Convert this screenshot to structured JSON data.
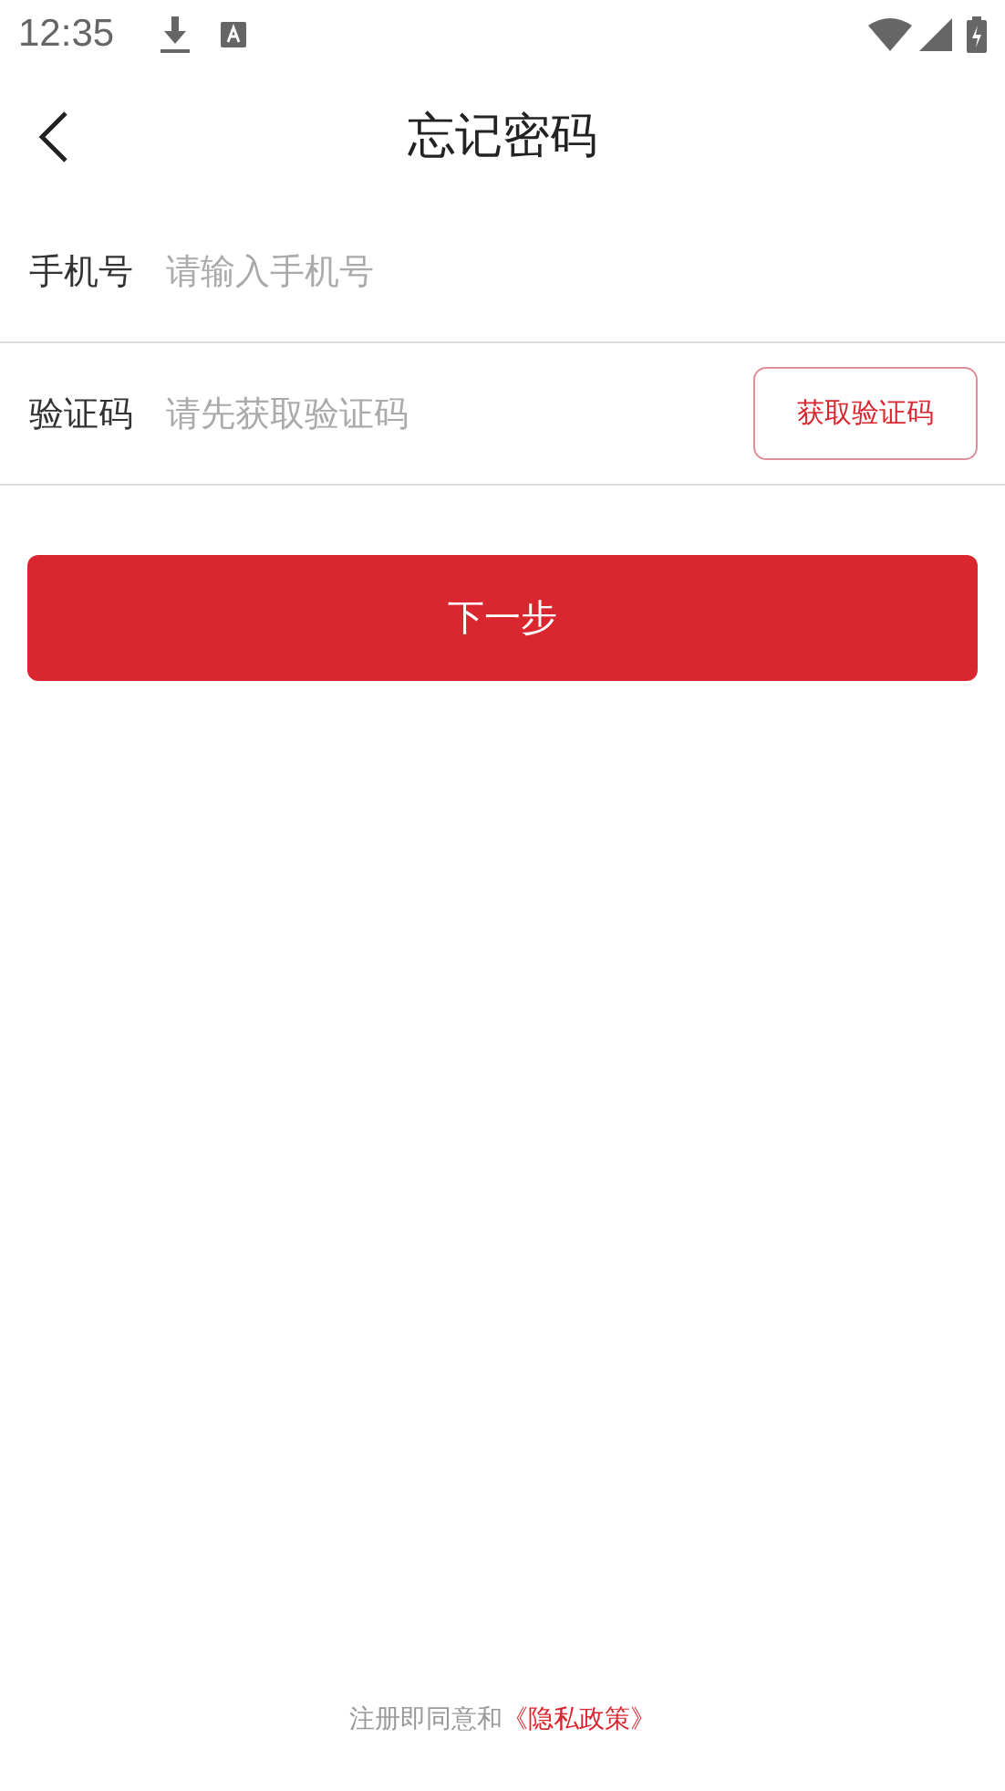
{
  "status_bar": {
    "time": "12:35"
  },
  "header": {
    "title": "忘记密码"
  },
  "fields": [
    {
      "label": "手机号",
      "placeholder": "请输入手机号"
    },
    {
      "label": "验证码",
      "placeholder": "请先获取验证码",
      "action": "获取验证码"
    }
  ],
  "next_button": "下一步",
  "footer": {
    "text": "注册即同意和",
    "link": "《隐私政策》"
  }
}
